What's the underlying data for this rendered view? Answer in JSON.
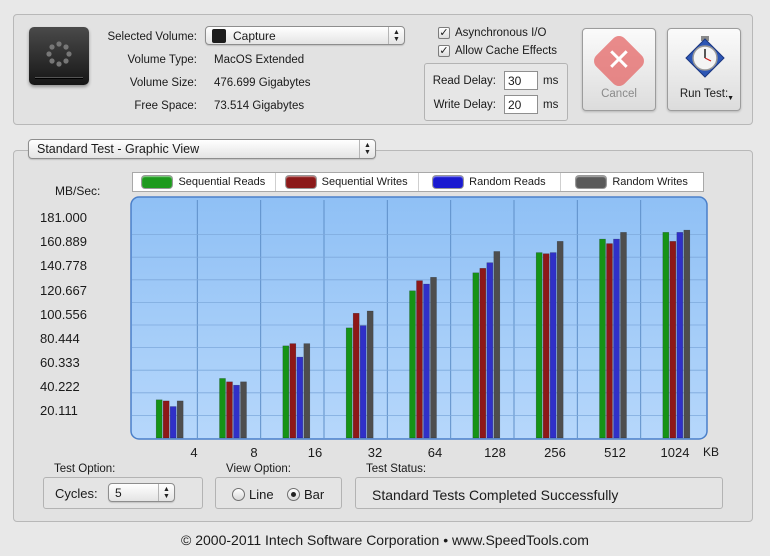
{
  "volume": {
    "selected_label": "Selected Volume:",
    "selected_value": "Capture",
    "type_label": "Volume Type:",
    "type_value": "MacOS Extended",
    "size_label": "Volume Size:",
    "size_value": "476.699 Gigabytes",
    "free_label": "Free Space:",
    "free_value": "73.514 Gigabytes"
  },
  "options": {
    "async_label": "Asynchronous I/O",
    "async_checked": true,
    "cache_label": "Allow Cache Effects",
    "cache_checked": true,
    "read_delay_label": "Read Delay:",
    "read_delay_value": "30",
    "write_delay_label": "Write Delay:",
    "write_delay_value": "20",
    "unit": "ms"
  },
  "buttons": {
    "cancel_label": "Cancel",
    "run_label": "Run Test:"
  },
  "view_select": "Standard Test - Graphic View",
  "legend": [
    {
      "label": "Sequential Reads",
      "color": "#1e9a1e"
    },
    {
      "label": "Sequential Writes",
      "color": "#8c1a1a"
    },
    {
      "label": "Random Reads",
      "color": "#1a1ad0"
    },
    {
      "label": "Random Writes",
      "color": "#5a5a5a"
    }
  ],
  "chart_data": {
    "type": "bar",
    "ylabel": "MB/Sec:",
    "xlabel": "KB",
    "ylim": [
      0,
      201.111
    ],
    "yticks": [
      "181.000",
      "160.889",
      "140.778",
      "120.667",
      "100.556",
      "80.444",
      "60.333",
      "40.222",
      "20.111"
    ],
    "categories": [
      "4",
      "8",
      "16",
      "32",
      "64",
      "128",
      "256",
      "512",
      "1024"
    ],
    "series": [
      {
        "name": "Sequential Reads",
        "color": "#169316",
        "values": [
          34,
          53,
          82,
          98,
          131,
          147,
          165,
          177,
          183
        ]
      },
      {
        "name": "Sequential Writes",
        "color": "#8e1818",
        "values": [
          33,
          50,
          84,
          111,
          140,
          151,
          164,
          173,
          175
        ]
      },
      {
        "name": "Random Reads",
        "color": "#3030c8",
        "values": [
          28,
          47,
          72,
          100,
          137,
          156,
          165,
          177,
          183
        ]
      },
      {
        "name": "Random Writes",
        "color": "#4e4e4e",
        "values": [
          33,
          50,
          84,
          113,
          143,
          166,
          175,
          183,
          185
        ]
      }
    ]
  },
  "test_option": {
    "label": "Test Option:",
    "cycles_label": "Cycles:",
    "cycles_value": "5"
  },
  "view_option": {
    "label": "View Option:",
    "line_label": "Line",
    "bar_label": "Bar",
    "selected": "Bar"
  },
  "test_status": {
    "label": "Test Status:",
    "value": "Standard Tests Completed Successfully"
  },
  "footer": "© 2000-2011 Intech Software Corporation • www.SpeedTools.com"
}
